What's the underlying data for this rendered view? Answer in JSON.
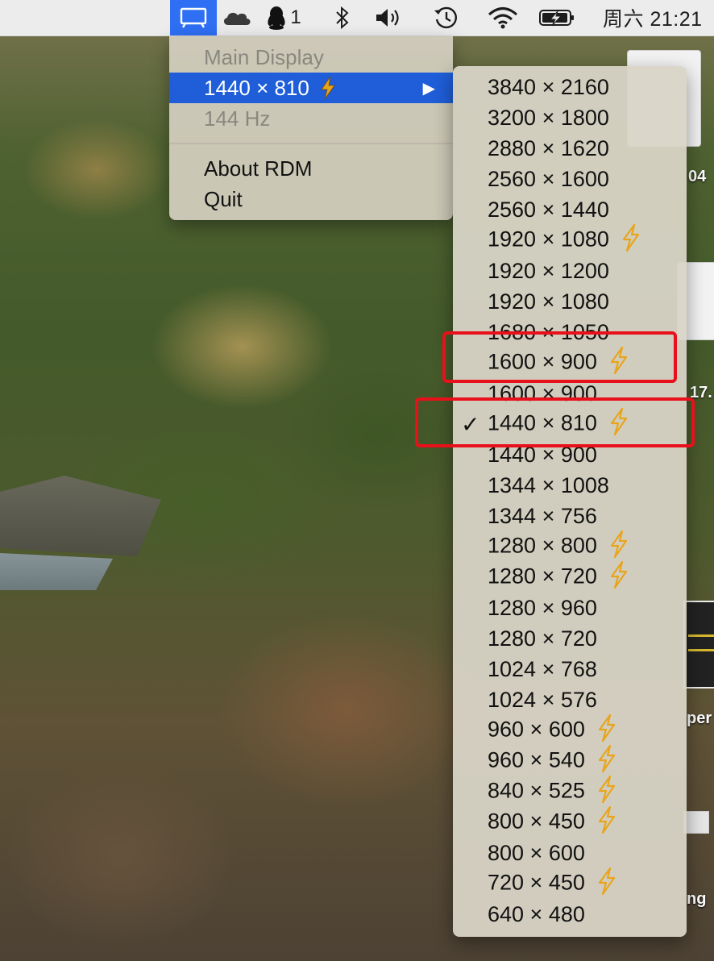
{
  "menubar": {
    "qq_badge": "1",
    "clock": "周六 21:21",
    "icons": [
      "rdm-display-icon",
      "onedrive-icon",
      "qq-icon",
      "bluetooth-icon",
      "volume-icon",
      "time-machine-icon",
      "wifi-icon",
      "battery-charging-icon"
    ]
  },
  "rdm_menu": {
    "main_display": "Main Display",
    "current_resolution": "1440 × 810",
    "current_is_hidpi": true,
    "refresh_rate": "144 Hz",
    "about": "About RDM",
    "quit": "Quit"
  },
  "resolutions": [
    {
      "label": "3840 × 2160",
      "hidpi": false,
      "selected": false
    },
    {
      "label": "3200 × 1800",
      "hidpi": false,
      "selected": false
    },
    {
      "label": "2880 × 1620",
      "hidpi": false,
      "selected": false
    },
    {
      "label": "2560 × 1600",
      "hidpi": false,
      "selected": false
    },
    {
      "label": "2560 × 1440",
      "hidpi": false,
      "selected": false
    },
    {
      "label": "1920 × 1080",
      "hidpi": true,
      "selected": false
    },
    {
      "label": "1920 × 1200",
      "hidpi": false,
      "selected": false
    },
    {
      "label": "1920 × 1080",
      "hidpi": false,
      "selected": false
    },
    {
      "label": "1680 × 1050",
      "hidpi": false,
      "selected": false
    },
    {
      "label": "1600 × 900",
      "hidpi": true,
      "selected": false
    },
    {
      "label": "1600 × 900",
      "hidpi": false,
      "selected": false
    },
    {
      "label": "1440 × 810",
      "hidpi": true,
      "selected": true
    },
    {
      "label": "1440 × 900",
      "hidpi": false,
      "selected": false
    },
    {
      "label": "1344 × 1008",
      "hidpi": false,
      "selected": false
    },
    {
      "label": "1344 × 756",
      "hidpi": false,
      "selected": false
    },
    {
      "label": "1280 × 800",
      "hidpi": true,
      "selected": false
    },
    {
      "label": "1280 × 720",
      "hidpi": true,
      "selected": false
    },
    {
      "label": "1280 × 960",
      "hidpi": false,
      "selected": false
    },
    {
      "label": "1280 × 720",
      "hidpi": false,
      "selected": false
    },
    {
      "label": "1024 × 768",
      "hidpi": false,
      "selected": false
    },
    {
      "label": "1024 × 576",
      "hidpi": false,
      "selected": false
    },
    {
      "label": "960 × 600",
      "hidpi": true,
      "selected": false
    },
    {
      "label": "960 × 540",
      "hidpi": true,
      "selected": false
    },
    {
      "label": "840 × 525",
      "hidpi": true,
      "selected": false
    },
    {
      "label": "800 × 450",
      "hidpi": true,
      "selected": false
    },
    {
      "label": "800 × 600",
      "hidpi": false,
      "selected": false
    },
    {
      "label": "720 × 450",
      "hidpi": true,
      "selected": false
    },
    {
      "label": "640 × 480",
      "hidpi": false,
      "selected": false
    }
  ],
  "check_mark": "✓",
  "desktop": {
    "label_1": "04",
    "label_2": "17.",
    "label_3": "per",
    "label_4": "ng"
  },
  "colors": {
    "menubar_highlight": "#2e6ff3",
    "menu_selection": "#1f5ed8",
    "bolt": "#e8a51c",
    "annotation_box": "#e8101a"
  }
}
